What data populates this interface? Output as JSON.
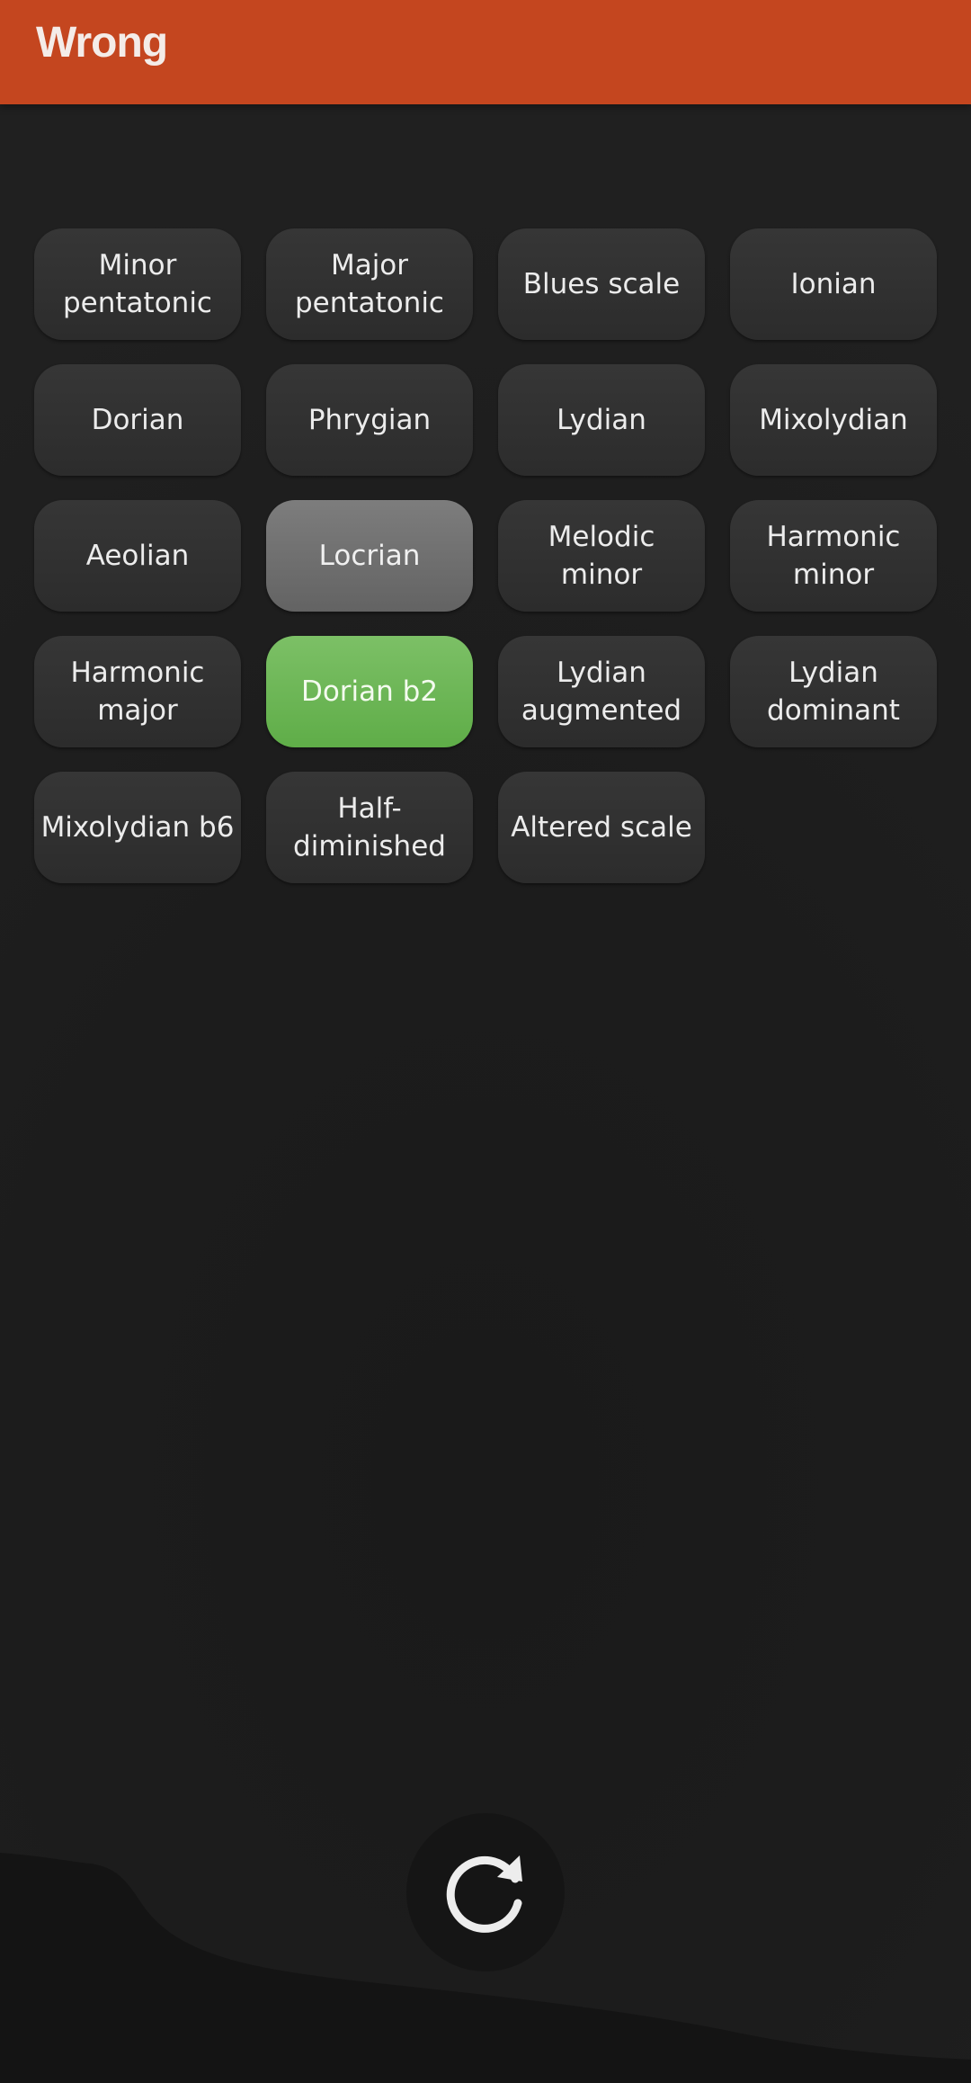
{
  "header": {
    "title": "Wrong",
    "background_color": "#c4461f"
  },
  "scales": [
    {
      "label": "Minor pentatonic",
      "state": "normal"
    },
    {
      "label": "Major pentatonic",
      "state": "normal"
    },
    {
      "label": "Blues scale",
      "state": "normal"
    },
    {
      "label": "Ionian",
      "state": "normal"
    },
    {
      "label": "Dorian",
      "state": "normal"
    },
    {
      "label": "Phrygian",
      "state": "normal"
    },
    {
      "label": "Lydian",
      "state": "normal"
    },
    {
      "label": "Mixolydian",
      "state": "normal"
    },
    {
      "label": "Aeolian",
      "state": "normal"
    },
    {
      "label": "Locrian",
      "state": "selected"
    },
    {
      "label": "Melodic minor",
      "state": "normal"
    },
    {
      "label": "Harmonic minor",
      "state": "normal"
    },
    {
      "label": "Harmonic major",
      "state": "normal"
    },
    {
      "label": "Dorian b2",
      "state": "correct"
    },
    {
      "label": "Lydian augmented",
      "state": "normal"
    },
    {
      "label": "Lydian dominant",
      "state": "normal"
    },
    {
      "label": "Mixolydian b6",
      "state": "normal"
    },
    {
      "label": "Half-diminished",
      "state": "normal"
    },
    {
      "label": "Altered scale",
      "state": "normal"
    }
  ],
  "refresh_button": {
    "icon": "refresh-icon"
  },
  "colors": {
    "correct": "#6ab954",
    "selected_wrong": "#717171",
    "button": "#313131"
  }
}
